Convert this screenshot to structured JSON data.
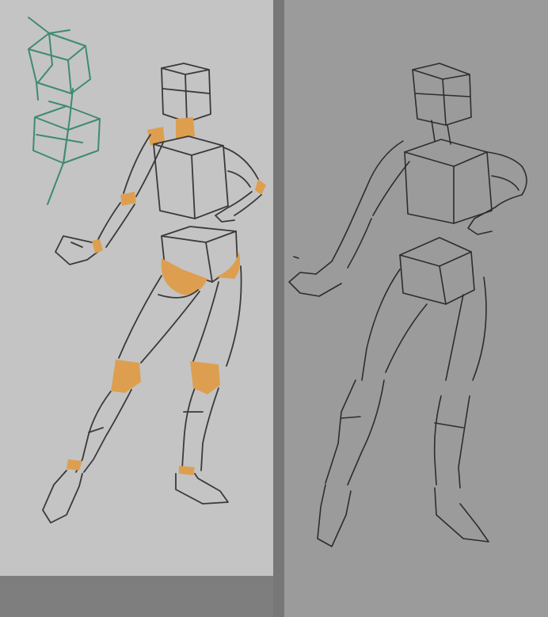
{
  "artwork": {
    "kind": "figure-drawing-comparison",
    "panels": [
      {
        "id": "left",
        "description_name": "mannequin-construction-sketch",
        "background": "#c4c4c4",
        "line_color": "#3a3a3a",
        "accent_color": "#dd9f4f",
        "guide_color": "#3f8a72"
      },
      {
        "id": "right",
        "description_name": "gesture-line-sketch",
        "background": "#9b9b9b",
        "line_color": "#2d2d2d"
      }
    ]
  }
}
